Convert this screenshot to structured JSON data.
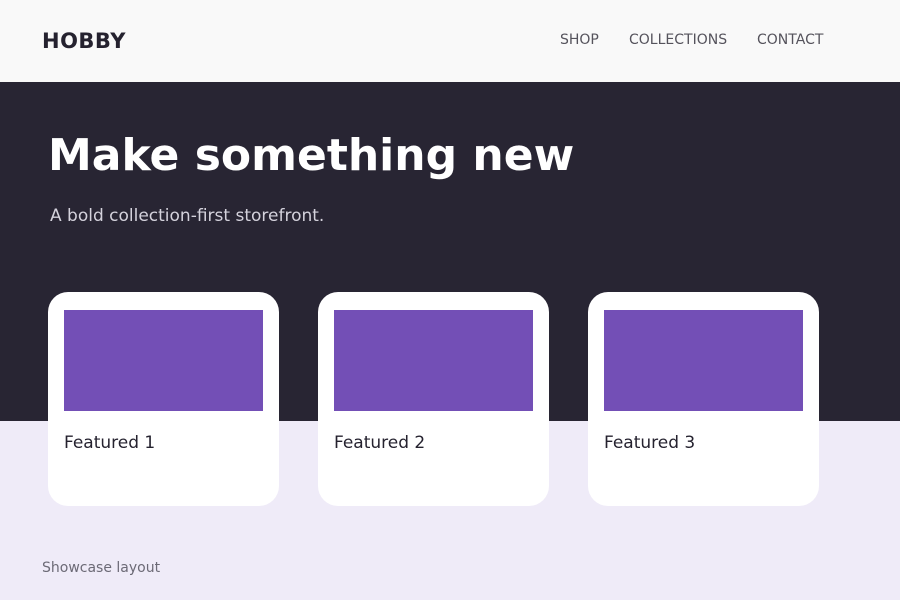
{
  "header": {
    "brand": "HOBBY",
    "nav": [
      {
        "label": "SHOP"
      },
      {
        "label": "COLLECTIONS"
      },
      {
        "label": "CONTACT"
      }
    ]
  },
  "hero": {
    "title": "Make something new",
    "subtitle": "A bold collection-first storefront."
  },
  "cards": [
    {
      "title": "Featured 1"
    },
    {
      "title": "Featured 2"
    },
    {
      "title": "Featured 3"
    }
  ],
  "footer": {
    "note": "Showcase layout"
  },
  "colors": {
    "header_bg": "#f9f9f9",
    "hero_bg": "#282533",
    "page_bg": "#efebf8",
    "card_bg": "#ffffff",
    "accent": "#734fb6",
    "text_dark": "#25222f"
  }
}
